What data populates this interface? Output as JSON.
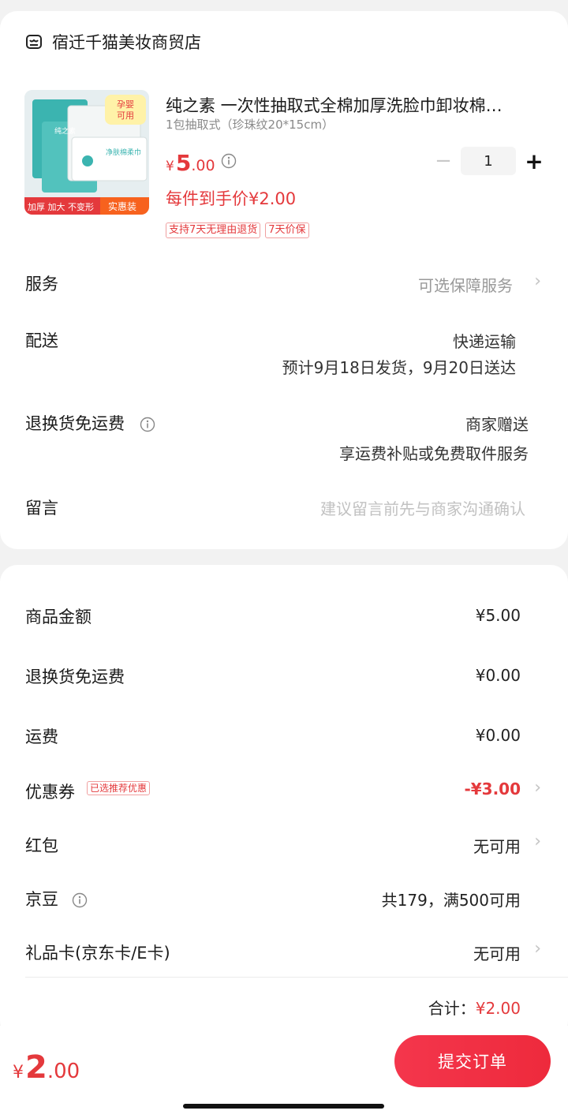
{
  "shop": {
    "name": "宿迁千猫美妆商贸店"
  },
  "product": {
    "title": "纯之素 一次性抽取式全棉加厚洗脸巾卸妆棉…",
    "spec": "1包抽取式（珍珠纹20*15cm）",
    "price_symbol": "¥",
    "price_int": "5",
    "price_dec": ".00",
    "per_item_price": "每件到手价¥2.00",
    "tags": [
      "支持7天无理由退货",
      "7天价保"
    ],
    "quantity": "1",
    "image": {
      "badge_top": "孕婴可用",
      "label_left": "加厚 加大 不变形",
      "label_right": "实惠装",
      "pack_text": "净肤棉柔巾",
      "brand_text": "纯之素"
    }
  },
  "order": {
    "service": {
      "label": "服务",
      "value": "可选保障服务"
    },
    "delivery": {
      "label": "配送",
      "method": "快递运输",
      "estimate": "预计9月18日发货，9月20日送达"
    },
    "return_free": {
      "label": "退换货免运费",
      "value": "商家赠送",
      "sub": "享运费补贴或免费取件服务"
    },
    "message": {
      "label": "留言",
      "placeholder": "建议留言前先与商家沟通确认"
    }
  },
  "summary": {
    "goods_amount": {
      "label": "商品金额",
      "value": "¥5.00"
    },
    "return_fee": {
      "label": "退换货免运费",
      "value": "¥0.00"
    },
    "shipping": {
      "label": "运费",
      "value": "¥0.00"
    },
    "coupon": {
      "label": "优惠券",
      "badge": "已选推荐优惠",
      "value": "-¥3.00"
    },
    "red_packet": {
      "label": "红包",
      "value": "无可用"
    },
    "jingdou": {
      "label": "京豆",
      "value": "共179，满500可用"
    },
    "gift_card": {
      "label": "礼品卡(京东卡/E卡)",
      "value": "无可用"
    },
    "total_label": "合计：",
    "total_value": "¥2.00"
  },
  "bottom": {
    "total_symbol": "¥",
    "total_int": "2",
    "total_dec": ".00",
    "submit_label": "提交订单"
  },
  "colors": {
    "accent": "#e4393c",
    "button": "#f4364c"
  }
}
